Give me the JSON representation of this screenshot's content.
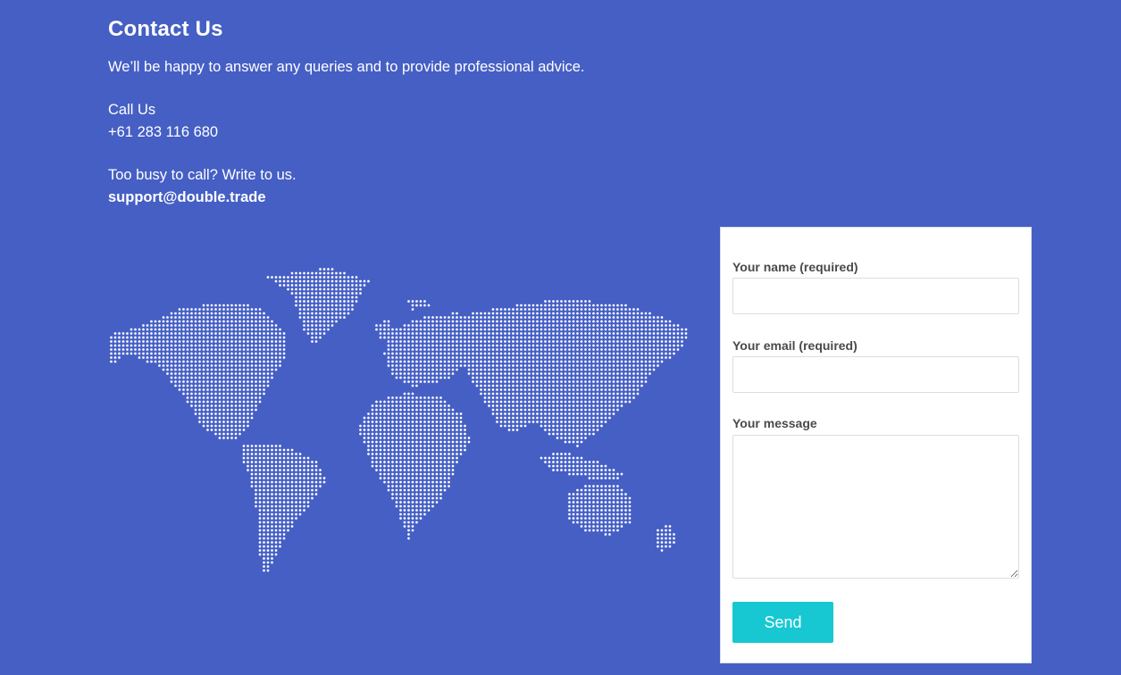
{
  "contact": {
    "title": "Contact Us",
    "intro": "We’ll be happy to answer any queries and to provide professional advice.",
    "call_label": "Call Us",
    "phone": "+61 283 116 680",
    "write_label": "Too busy to call? Write to us.",
    "email": "support@double.trade"
  },
  "map": {
    "icon": "dotted-world-map",
    "dot_color": "#ffffff"
  },
  "form": {
    "name_label": "Your name (required)",
    "name_value": "",
    "email_label": "Your email (required)",
    "email_value": "",
    "message_label": "Your message",
    "message_value": "",
    "send_label": "Send"
  },
  "colors": {
    "background": "#455fc4",
    "panel": "#ffffff",
    "accent": "#17c8d3",
    "label_text": "#4a4a4a"
  }
}
